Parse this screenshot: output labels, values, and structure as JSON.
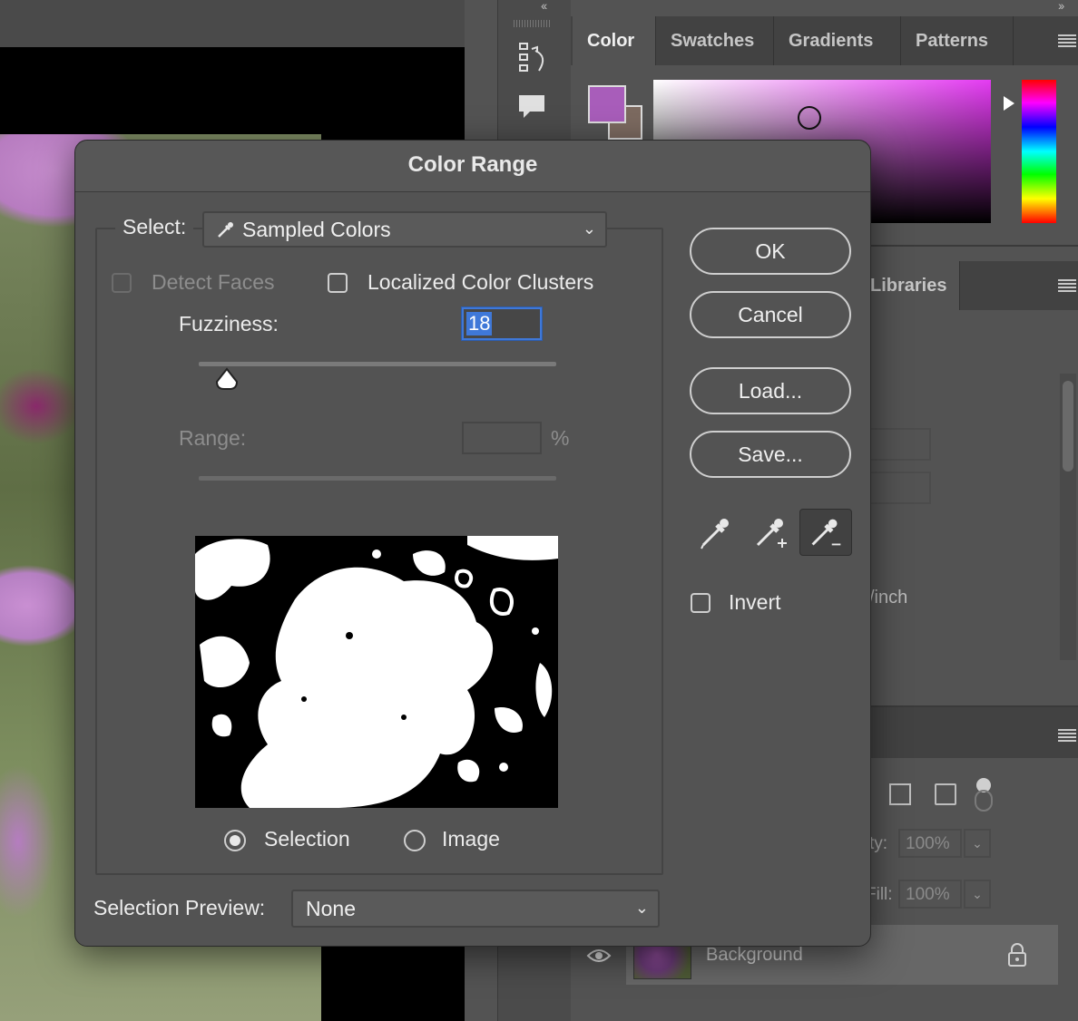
{
  "panels": {
    "color_tabs": [
      "Color",
      "Swatches",
      "Gradients",
      "Patterns"
    ],
    "active_color_tab": "Color",
    "foreground_color": "#a85dba",
    "background_color": "#7c6a60",
    "libraries_tab": "Libraries",
    "resolution_unit_fragment": "/inch",
    "layers": {
      "opacity_label": "ty:",
      "opacity_value": "100%",
      "fill_label": "Fill:",
      "fill_value": "100%",
      "layer_name": "Background"
    }
  },
  "dialog": {
    "title": "Color Range",
    "select_label": "Select:",
    "select_value": "Sampled Colors",
    "detect_faces_label": "Detect Faces",
    "detect_faces_checked": false,
    "localized_label": "Localized Color Clusters",
    "localized_checked": false,
    "fuzziness_label": "Fuzziness:",
    "fuzziness_value": "18",
    "range_label": "Range:",
    "range_value": "",
    "range_unit": "%",
    "preview_mode_selection": "Selection",
    "preview_mode_image": "Image",
    "preview_mode_selected": "Selection",
    "selection_preview_label": "Selection Preview:",
    "selection_preview_value": "None",
    "buttons": {
      "ok": "OK",
      "cancel": "Cancel",
      "load": "Load...",
      "save": "Save..."
    },
    "invert_label": "Invert",
    "invert_checked": false
  }
}
